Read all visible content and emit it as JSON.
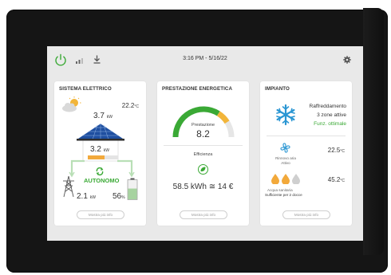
{
  "header": {
    "clock": "3:16 PM - 5/16/22"
  },
  "cards": {
    "electric": {
      "title": "SISTEMA ELETTRICO",
      "temperature_value": "22.2",
      "temperature_unit": "°C",
      "solar_value": "3.7",
      "solar_unit": "kW",
      "home_value": "3.2",
      "home_unit": "kW",
      "mode_label": "AUTONOMO",
      "grid_value": "2.1",
      "grid_unit": "kW",
      "battery_value": "56",
      "battery_unit": "%",
      "battery_level": 0.56,
      "more_label": "Mostra più info"
    },
    "energy": {
      "title": "PRESTAZIONE ENERGETICA",
      "gauge_label": "Prestazione",
      "gauge_value": "8.2",
      "gauge_fraction": 0.82,
      "efficiency_label": "Efficienza",
      "energy_value": "58.5 kWh ≅ 14 €",
      "more_label": "Mostra più info"
    },
    "plant": {
      "title": "IMPIANTO",
      "mode_label": "Raffreddamento",
      "zones_label": "3 zone attive",
      "status_label": "Funz. ottimale",
      "air_label": "Rinnovo aria",
      "air_status": "Attivo",
      "air_temp": "22.5",
      "air_unit": "°C",
      "water_label": "Acqua sanitaria",
      "water_status": "Sufficiente per 2 docce",
      "water_temp": "45.2",
      "water_unit": "°C",
      "more_label": "Mostra più info"
    }
  },
  "colors": {
    "accent": "#3aa935",
    "orange": "#f2a93b",
    "blue": "#2a96d3"
  }
}
